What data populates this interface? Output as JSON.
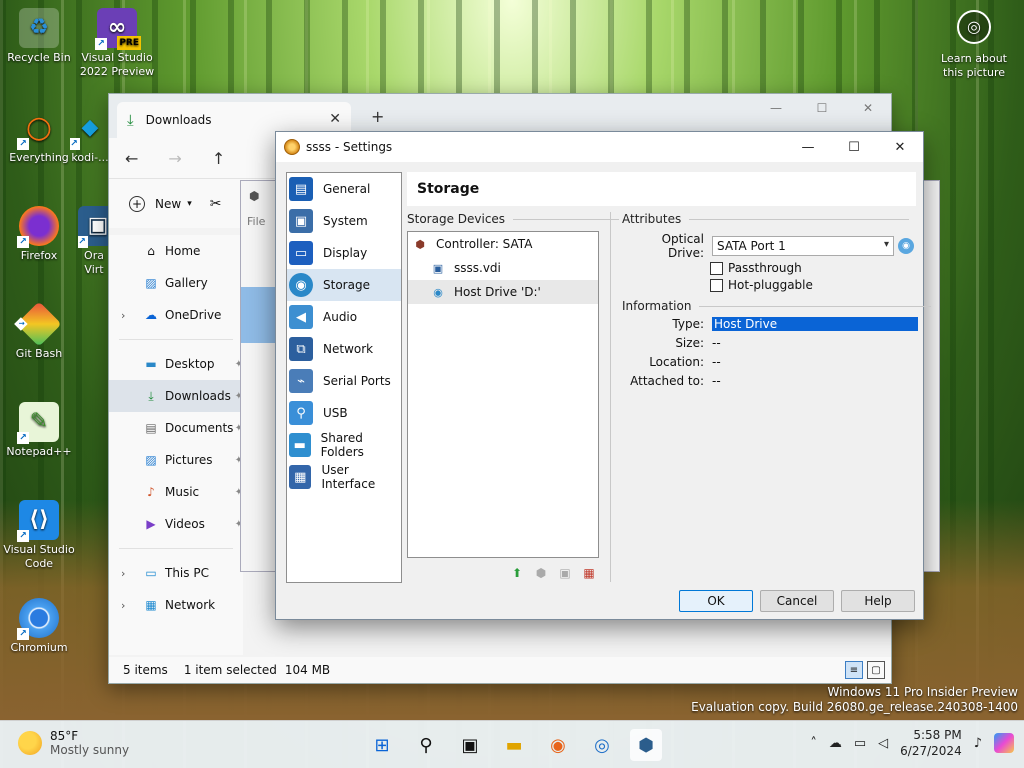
{
  "desktop": {
    "icons": [
      {
        "label": "Recycle Bin",
        "icon": "recycle-bin-icon"
      },
      {
        "label": "Visual Studio 2022 Preview",
        "icon": "visual-studio-icon",
        "badge": "PRE"
      },
      {
        "label": "Everything",
        "icon": "everything-search-icon"
      },
      {
        "label": "kodi-...",
        "icon": "kodi-icon"
      },
      {
        "label": "Firefox",
        "icon": "firefox-icon"
      },
      {
        "label": "Ora Virt",
        "icon": "virtualbox-icon"
      },
      {
        "label": "Git Bash",
        "icon": "git-bash-icon"
      },
      {
        "label": "Notepad++",
        "icon": "notepad-plus-plus-icon"
      },
      {
        "label": "Visual Studio Code",
        "icon": "vscode-icon"
      },
      {
        "label": "Chromium",
        "icon": "chromium-icon"
      }
    ],
    "learn_label": "Learn about this picture"
  },
  "explorer": {
    "tab_title": "Downloads",
    "new_label": "New",
    "file_label": "File",
    "sidebar": [
      {
        "label": "Home",
        "icon": "home-icon"
      },
      {
        "label": "Gallery",
        "icon": "gallery-icon"
      },
      {
        "label": "OneDrive",
        "icon": "onedrive-icon"
      },
      {
        "label": "Desktop",
        "icon": "desktop-folder-icon"
      },
      {
        "label": "Downloads",
        "icon": "downloads-icon"
      },
      {
        "label": "Documents",
        "icon": "documents-icon"
      },
      {
        "label": "Pictures",
        "icon": "pictures-icon"
      },
      {
        "label": "Music",
        "icon": "music-icon"
      },
      {
        "label": "Videos",
        "icon": "videos-icon"
      },
      {
        "label": "This PC",
        "icon": "this-pc-icon"
      },
      {
        "label": "Network",
        "icon": "network-icon"
      }
    ],
    "status": {
      "items": "5 items",
      "selected": "1 item selected",
      "size": "104 MB"
    }
  },
  "dialog": {
    "title": "ssss - Settings",
    "categories": [
      {
        "label": "General",
        "icon": "general-icon",
        "color": "#1a5fb4"
      },
      {
        "label": "System",
        "icon": "system-chip-icon",
        "color": "#3b6ea8"
      },
      {
        "label": "Display",
        "icon": "display-icon",
        "color": "#1d5fbf"
      },
      {
        "label": "Storage",
        "icon": "storage-disk-icon",
        "color": "#2a88c8"
      },
      {
        "label": "Audio",
        "icon": "audio-speaker-icon",
        "color": "#3d8fd1"
      },
      {
        "label": "Network",
        "icon": "network-adapter-icon",
        "color": "#2c5f9e"
      },
      {
        "label": "Serial Ports",
        "icon": "serial-port-icon",
        "color": "#4a7db8"
      },
      {
        "label": "USB",
        "icon": "usb-icon",
        "color": "#3a8fd8"
      },
      {
        "label": "Shared Folders",
        "icon": "shared-folder-icon",
        "color": "#2f8fd0"
      },
      {
        "label": "User Interface",
        "icon": "user-interface-icon",
        "color": "#3366aa"
      }
    ],
    "selected_category": "Storage",
    "page_title": "Storage",
    "storage_devices_label": "Storage Devices",
    "tree": {
      "controller": "Controller: SATA",
      "disk": "ssss.vdi",
      "optical": "Host Drive 'D:'"
    },
    "attributes": {
      "section_label": "Attributes",
      "optical_drive_label": "Optical Drive:",
      "optical_drive_value": "SATA Port 1",
      "passthrough_label": "Passthrough",
      "hotplug_label": "Hot-pluggable"
    },
    "information": {
      "section_label": "Information",
      "rows": [
        {
          "label": "Type:",
          "value": "Host Drive"
        },
        {
          "label": "Size:",
          "value": "--"
        },
        {
          "label": "Location:",
          "value": "--"
        },
        {
          "label": "Attached to:",
          "value": "--"
        }
      ]
    },
    "buttons": {
      "ok": "OK",
      "cancel": "Cancel",
      "help": "Help"
    }
  },
  "watermark": {
    "line1": "Windows 11 Pro Insider Preview",
    "line2": "Evaluation copy. Build 26080.ge_release.240308-1400"
  },
  "taskbar": {
    "weather_temp": "85°F",
    "weather_desc": "Mostly sunny",
    "time": "5:58 PM",
    "date": "6/27/2024"
  }
}
